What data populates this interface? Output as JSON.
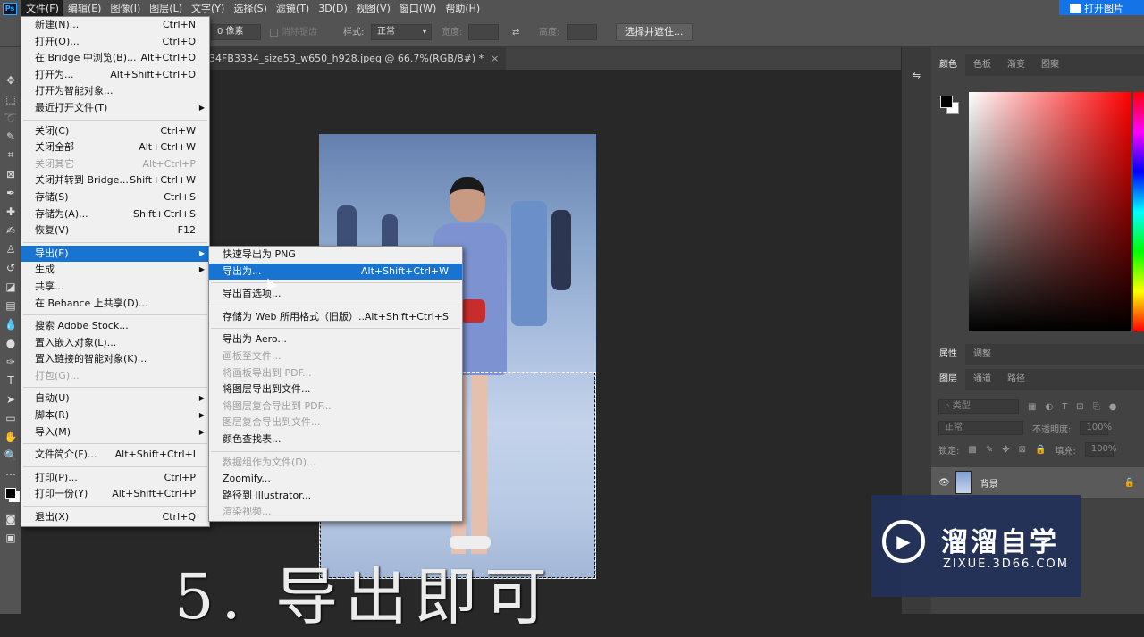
{
  "menubar": {
    "logo": "Ps",
    "items": [
      "文件(F)",
      "编辑(E)",
      "图像(I)",
      "图层(L)",
      "文字(Y)",
      "选择(S)",
      "滤镜(T)",
      "3D(D)",
      "视图(V)",
      "窗口(W)",
      "帮助(H)"
    ],
    "active_index": 0
  },
  "topright": {
    "label": "打开图片"
  },
  "options": {
    "feather_value": "0 像素",
    "antialias_label": "消除锯齿",
    "style_label": "样式:",
    "style_value": "正常",
    "width_label": "宽度:",
    "height_label": "高度:",
    "select_mask_button": "选择并遮住..."
  },
  "document": {
    "tab_title": "34FB3334_size53_w650_h928.jpeg @ 66.7%(RGB/8#) *",
    "close": "×"
  },
  "file_menu": {
    "items": [
      {
        "label": "新建(N)...",
        "shortcut": "Ctrl+N"
      },
      {
        "label": "打开(O)...",
        "shortcut": "Ctrl+O"
      },
      {
        "label": "在 Bridge 中浏览(B)...",
        "shortcut": "Alt+Ctrl+O"
      },
      {
        "label": "打开为...",
        "shortcut": "Alt+Shift+Ctrl+O"
      },
      {
        "label": "打开为智能对象...",
        "shortcut": ""
      },
      {
        "label": "最近打开文件(T)",
        "shortcut": "",
        "submenu": true
      },
      {
        "sep": true
      },
      {
        "label": "关闭(C)",
        "shortcut": "Ctrl+W"
      },
      {
        "label": "关闭全部",
        "shortcut": "Alt+Ctrl+W"
      },
      {
        "label": "关闭其它",
        "shortcut": "Alt+Ctrl+P",
        "disabled": true
      },
      {
        "label": "关闭并转到 Bridge...",
        "shortcut": "Shift+Ctrl+W"
      },
      {
        "label": "存储(S)",
        "shortcut": "Ctrl+S"
      },
      {
        "label": "存储为(A)...",
        "shortcut": "Shift+Ctrl+S"
      },
      {
        "label": "恢复(V)",
        "shortcut": "F12"
      },
      {
        "sep": true
      },
      {
        "label": "导出(E)",
        "shortcut": "",
        "submenu": true,
        "highlight": true
      },
      {
        "label": "生成",
        "shortcut": "",
        "submenu": true
      },
      {
        "label": "共享...",
        "shortcut": ""
      },
      {
        "label": "在 Behance 上共享(D)...",
        "shortcut": ""
      },
      {
        "sep": true
      },
      {
        "label": "搜索 Adobe Stock...",
        "shortcut": ""
      },
      {
        "label": "置入嵌入对象(L)...",
        "shortcut": ""
      },
      {
        "label": "置入链接的智能对象(K)...",
        "shortcut": ""
      },
      {
        "label": "打包(G)...",
        "shortcut": "",
        "disabled": true
      },
      {
        "sep": true
      },
      {
        "label": "自动(U)",
        "shortcut": "",
        "submenu": true
      },
      {
        "label": "脚本(R)",
        "shortcut": "",
        "submenu": true
      },
      {
        "label": "导入(M)",
        "shortcut": "",
        "submenu": true
      },
      {
        "sep": true
      },
      {
        "label": "文件简介(F)...",
        "shortcut": "Alt+Shift+Ctrl+I"
      },
      {
        "sep": true
      },
      {
        "label": "打印(P)...",
        "shortcut": "Ctrl+P"
      },
      {
        "label": "打印一份(Y)",
        "shortcut": "Alt+Shift+Ctrl+P"
      },
      {
        "sep": true
      },
      {
        "label": "退出(X)",
        "shortcut": "Ctrl+Q"
      }
    ]
  },
  "export_submenu": {
    "items": [
      {
        "label": "快速导出为 PNG",
        "shortcut": ""
      },
      {
        "label": "导出为...",
        "shortcut": "Alt+Shift+Ctrl+W",
        "highlight": true
      },
      {
        "sep": true
      },
      {
        "label": "导出首选项...",
        "shortcut": ""
      },
      {
        "sep": true
      },
      {
        "label": "存储为 Web 所用格式（旧版）...",
        "shortcut": "Alt+Shift+Ctrl+S"
      },
      {
        "sep": true
      },
      {
        "label": "导出为 Aero...",
        "shortcut": ""
      },
      {
        "label": "画板至文件...",
        "shortcut": "",
        "disabled": true
      },
      {
        "label": "将画板导出到 PDF...",
        "shortcut": "",
        "disabled": true
      },
      {
        "label": "将图层导出到文件...",
        "shortcut": ""
      },
      {
        "label": "将图层复合导出到 PDF...",
        "shortcut": "",
        "disabled": true
      },
      {
        "label": "图层复合导出到文件...",
        "shortcut": "",
        "disabled": true
      },
      {
        "label": "颜色查找表...",
        "shortcut": ""
      },
      {
        "sep": true
      },
      {
        "label": "数据组作为文件(D)...",
        "shortcut": "",
        "disabled": true
      },
      {
        "label": "Zoomify...",
        "shortcut": ""
      },
      {
        "label": "路径到 Illustrator...",
        "shortcut": ""
      },
      {
        "label": "渲染视频...",
        "shortcut": "",
        "disabled": true
      }
    ]
  },
  "caption": "5. 导出即可",
  "panels": {
    "color_tabs": [
      "颜色",
      "色板",
      "渐变",
      "图案"
    ],
    "prop_tabs": [
      "属性",
      "调整"
    ],
    "layer_tabs": [
      "图层",
      "通道",
      "路径"
    ],
    "kind_placeholder": "类型",
    "blend_mode": "正常",
    "opacity_label": "不透明度:",
    "opacity_value": "100%",
    "lock_label": "锁定:",
    "fill_label": "填充:",
    "fill_value": "100%",
    "layer_name": "背景"
  },
  "watermark": {
    "title": "溜溜自学",
    "url": "ZIXUE.3D66.COM"
  }
}
